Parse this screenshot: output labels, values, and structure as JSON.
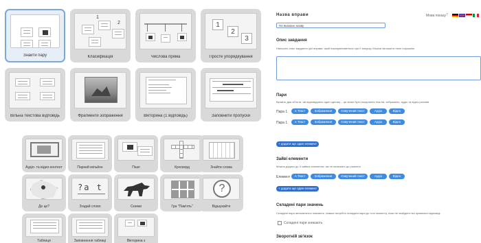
{
  "gallery": {
    "row1": [
      {
        "label": "Знайти пару",
        "selected": true
      },
      {
        "label": "Класифікація"
      },
      {
        "label": "Числова пряма"
      },
      {
        "label": "Просте упорядкування"
      }
    ],
    "row2": [
      {
        "label": "Вільна текстова відповідь"
      },
      {
        "label": "Фрагменти зображення"
      },
      {
        "label": "Вікторина (1 відповідь)"
      },
      {
        "label": "Заповнити пропуски"
      }
    ],
    "row3": [
      {
        "label": "Аудіо- та відео-контент"
      },
      {
        "label": "Парний мільйон"
      },
      {
        "label": "Пазл"
      },
      {
        "label": "Кросворд"
      },
      {
        "label": "Знайти слова"
      }
    ],
    "row4": [
      {
        "label": "Де це?"
      },
      {
        "label": "Згадай слово"
      },
      {
        "label": "Скачки"
      },
      {
        "label": "Гра \"Пам'ять\""
      },
      {
        "label": "Відшукайте"
      }
    ],
    "row5": [
      {
        "label": "Таблиця"
      },
      {
        "label": "Заповнення таблиці"
      },
      {
        "label": "Вікторина з"
      }
    ],
    "thumb_text": {
      "n1": "1",
      "n2": "2",
      "n3": "3",
      "n1b": "1",
      "n2b": "2",
      "letters": "?a t",
      "question": "?"
    }
  },
  "form": {
    "title": "Назва вправи",
    "lang_label": "Мова показу",
    "title_value": "Не вказано назву",
    "desc_heading": "Опис завдання",
    "desc_hint": "Напишіть опис завдання цієї вправи, який показуватиметься при її запуску. Можна залишити поле порожнім.",
    "pairs_heading": "Пари",
    "pairs_hint": "Вкажіть два об'єкти, які відповідають один одному – це може бути поєднання текстів, зображень, аудіо та відео-роликів",
    "pair_rows": [
      "Пара 1",
      "Пара 1"
    ],
    "pill_labels": [
      "А Текст",
      "Зображення",
      "Озвучений текст",
      "Аудіо",
      "Відео"
    ],
    "add_pair": "+ додати ще один елемент",
    "extra_heading": "Зайві елементи",
    "extra_hint": "Можна додати до 3 зайвих елементів, які не належать до рішення",
    "extra_row": "Елемент",
    "add_extra": "+ додати ще один елемент",
    "complex_heading": "Складені пари значень",
    "complex_hint": "Складені пари автоматично зникають, інакше потрібно складати пари до того моменту, поки не знайдено всі правильні відповіді.",
    "complex_checkbox": "Складені пари зникають",
    "feedback_heading": "Зворотній зв'язок",
    "colors": {
      "accent": "#3e8be0",
      "field_border": "#6f9bd6"
    }
  }
}
